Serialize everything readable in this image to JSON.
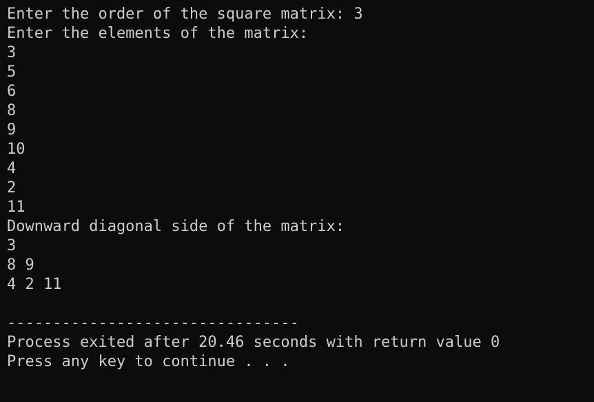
{
  "console": {
    "lines": [
      "Enter the order of the square matrix: 3",
      "Enter the elements of the matrix:",
      "3",
      "5",
      "6",
      "8",
      "9",
      "10",
      "4",
      "2",
      "11",
      "Downward diagonal side of the matrix:",
      "3",
      "8 9",
      "4 2 11",
      "",
      "--------------------------------",
      "Process exited after 20.46 seconds with return value 0",
      "Press any key to continue . . ."
    ]
  }
}
